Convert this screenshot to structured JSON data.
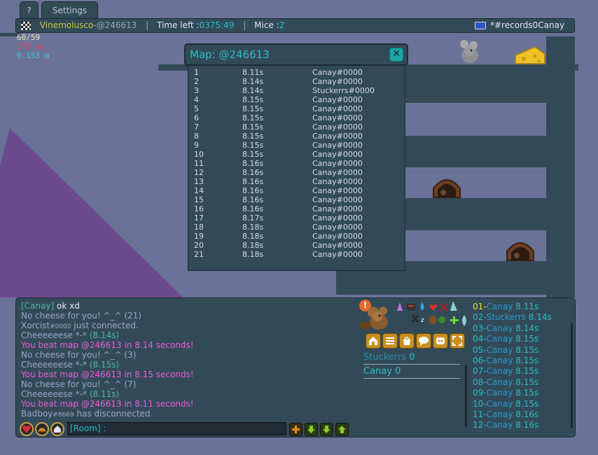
{
  "tabs": [
    {
      "label": "?"
    },
    {
      "label": "Settings"
    }
  ],
  "header": {
    "player_name": "Vinemolusco",
    "separator": " - ",
    "map_code": "@246613",
    "time_label": "Time left : ",
    "time_value": "0375:49",
    "mice_label": "Mice : ",
    "mice_value": "2",
    "room_name": "*#records0Canay"
  },
  "stats": {
    "fps": "60/59",
    "ping": "176 mo",
    "distance": "0.153 m"
  },
  "map_popup": {
    "title": "Map: @246613",
    "close_symbol": "✕",
    "records": [
      {
        "rank": "1",
        "time": "8.11s",
        "player": "Canay#0000"
      },
      {
        "rank": "2",
        "time": "8.14s",
        "player": "Canay#0000"
      },
      {
        "rank": "3",
        "time": "8.14s",
        "player": "Stuckerrs#0000"
      },
      {
        "rank": "4",
        "time": "8.15s",
        "player": "Canay#0000"
      },
      {
        "rank": "5",
        "time": "8.15s",
        "player": "Canay#0000"
      },
      {
        "rank": "6",
        "time": "8.15s",
        "player": "Canay#0000"
      },
      {
        "rank": "7",
        "time": "8.15s",
        "player": "Canay#0000"
      },
      {
        "rank": "8",
        "time": "8.15s",
        "player": "Canay#0000"
      },
      {
        "rank": "9",
        "time": "8.15s",
        "player": "Canay#0000"
      },
      {
        "rank": "10",
        "time": "8.15s",
        "player": "Canay#0000"
      },
      {
        "rank": "11",
        "time": "8.16s",
        "player": "Canay#0000"
      },
      {
        "rank": "12",
        "time": "8.16s",
        "player": "Canay#0000"
      },
      {
        "rank": "13",
        "time": "8.16s",
        "player": "Canay#0000"
      },
      {
        "rank": "14",
        "time": "8.16s",
        "player": "Canay#0000"
      },
      {
        "rank": "15",
        "time": "8.16s",
        "player": "Canay#0000"
      },
      {
        "rank": "16",
        "time": "8.16s",
        "player": "Canay#0000"
      },
      {
        "rank": "17",
        "time": "8.17s",
        "player": "Canay#0000"
      },
      {
        "rank": "18",
        "time": "8.18s",
        "player": "Canay#0000"
      },
      {
        "rank": "19",
        "time": "8.18s",
        "player": "Canay#0000"
      },
      {
        "rank": "20",
        "time": "8.18s",
        "player": "Canay#0000"
      },
      {
        "rank": "21",
        "time": "8.18s",
        "player": "Canay#0000"
      }
    ]
  },
  "chat": {
    "lines": [
      {
        "a": "[Canay] ",
        "b": "ok xd"
      },
      {
        "a": "No cheese for you! ^_^ (21)"
      },
      {
        "a": "Xorcist",
        "b": "#0000",
        "c": " just connected."
      },
      {
        "a": "Cheeeeeese *-* ",
        "b": "(8.14s)"
      },
      {
        "a": "You beat map @246613 in 8.14 seconds!"
      },
      {
        "a": "No cheese for you! ^_^ (3)"
      },
      {
        "a": "Cheeeeeese *-* ",
        "b": "(8.15s)"
      },
      {
        "a": "You beat map @246613 in 8.15 seconds!"
      },
      {
        "a": "No cheese for you! ^_^ (7)"
      },
      {
        "a": "Cheeeeeese *-* ",
        "b": "(8.11s)"
      },
      {
        "a": "You beat map @246613 in 8.11 seconds!"
      },
      {
        "a": "Badboy",
        "b": "#8669",
        "c": " has disconnected."
      }
    ],
    "input_placeholder": "[Room] :"
  },
  "scoreboard": [
    {
      "name": "Stuckerrs",
      "score": "0"
    },
    {
      "name": "Canay",
      "score": "0"
    }
  ],
  "rankings": [
    {
      "pos": "01",
      "name": "Canay",
      "time": "8.11s"
    },
    {
      "pos": "02",
      "name": "Stuckerrs",
      "time": "8.14s"
    },
    {
      "pos": "03",
      "name": "Canay",
      "time": "8.14s"
    },
    {
      "pos": "04",
      "name": "Canay",
      "time": "8.15s"
    },
    {
      "pos": "05",
      "name": "Canay",
      "time": "8.15s"
    },
    {
      "pos": "06",
      "name": "Canay",
      "time": "8.15s"
    },
    {
      "pos": "07",
      "name": "Canay",
      "time": "8.15s"
    },
    {
      "pos": "08",
      "name": "Canay",
      "time": "8.15s"
    },
    {
      "pos": "09",
      "name": "Canay",
      "time": "8.15s"
    },
    {
      "pos": "10",
      "name": "Canay",
      "time": "8.15s"
    },
    {
      "pos": "11",
      "name": "Canay",
      "time": "8.16s"
    },
    {
      "pos": "12",
      "name": "Canay",
      "time": "8.16s"
    }
  ],
  "colors": {
    "background": "#6a7397",
    "panel": "#324a58",
    "accent_cyan": "#2bbdc6",
    "accent_yellow": "#c8c83a",
    "chat_pink": "#ef5ad9",
    "purple_ground": "#6c4a8e"
  },
  "icons": [
    "checkered-flag-icon",
    "room-flag-icon",
    "alert-icon",
    "house-icon",
    "list-icon",
    "shop-icon",
    "chat-icon",
    "discord-icon",
    "fullscreen-icon",
    "heart-icon",
    "shaman-hat-icon",
    "tribe-house-icon",
    "plus-icon",
    "arrow-down-icon",
    "arrow-up-icon"
  ]
}
